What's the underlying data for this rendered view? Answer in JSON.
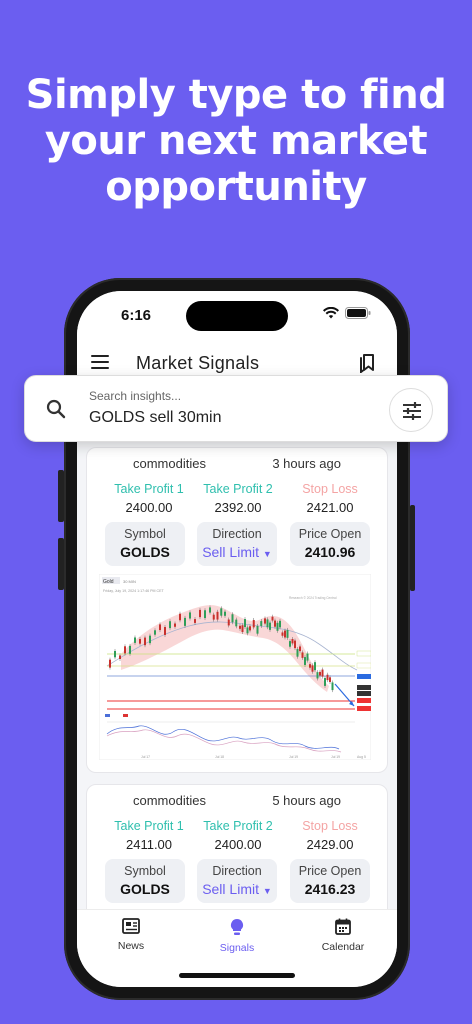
{
  "headline": "Simply type to find your next market opportunity",
  "status_bar": {
    "time": "6:16"
  },
  "app_bar": {
    "title": "Market Signals"
  },
  "search": {
    "placeholder": "Search insights...",
    "value": "GOLDS sell 30min"
  },
  "signals": [
    {
      "category": "commodities",
      "time": "3 hours ago",
      "tp1_label": "Take Profit 1",
      "tp1": "2400.00",
      "tp2_label": "Take Profit 2",
      "tp2": "2392.00",
      "sl_label": "Stop Loss",
      "sl": "2421.00",
      "symbol_label": "Symbol",
      "symbol": "GOLDS",
      "direction_label": "Direction",
      "direction": "Sell Limit",
      "price_label": "Price Open",
      "price": "2410.96"
    },
    {
      "category": "commodities",
      "time": "5 hours ago",
      "tp1_label": "Take Profit 1",
      "tp1": "2411.00",
      "tp2_label": "Take Profit 2",
      "tp2": "2400.00",
      "sl_label": "Stop Loss",
      "sl": "2429.00",
      "symbol_label": "Symbol",
      "symbol": "GOLDS",
      "direction_label": "Direction",
      "direction": "Sell Limit",
      "price_label": "Price Open",
      "price": "2416.23"
    }
  ],
  "chart_header": {
    "symbol": "Gold",
    "timeframe": "30 MIN",
    "date": "Friday, July 19, 2024 1:17:46 PM CET",
    "credit": "Research © 2024 Trading Central"
  },
  "chart_labels": {
    "x": [
      "Jul 17",
      "Jul 18",
      "Jul 19",
      "Jul 19",
      "Aug 5"
    ]
  },
  "bottom_nav": [
    {
      "label": "News",
      "icon": "newspaper-icon",
      "active": false
    },
    {
      "label": "Signals",
      "icon": "lightbulb-icon",
      "active": true
    },
    {
      "label": "Calendar",
      "icon": "calendar-icon",
      "active": false
    }
  ],
  "colors": {
    "background": "#6b5ef0",
    "accent": "#6b5ef0",
    "take_profit": "#2fbfae",
    "stop_loss": "#f4a4a4"
  }
}
